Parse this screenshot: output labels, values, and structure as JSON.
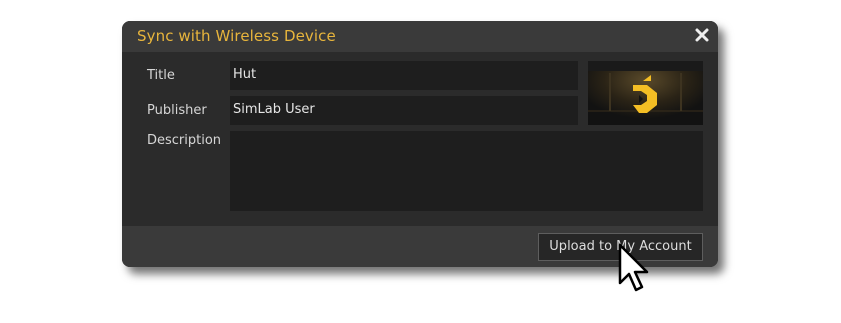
{
  "dialog": {
    "title": "Sync with Wireless Device",
    "close_icon": "close-icon",
    "title_color": "#e8b53c"
  },
  "form": {
    "title_label": "Title",
    "title_value": "Hut",
    "publisher_label": "Publisher",
    "publisher_value": "SimLab User",
    "description_label": "Description",
    "description_value": ""
  },
  "thumbnail": {
    "icon": "simlab-logo-icon"
  },
  "footer": {
    "upload_label": "Upload to My Account"
  },
  "pointer": {
    "icon": "arrow-cursor-icon"
  }
}
